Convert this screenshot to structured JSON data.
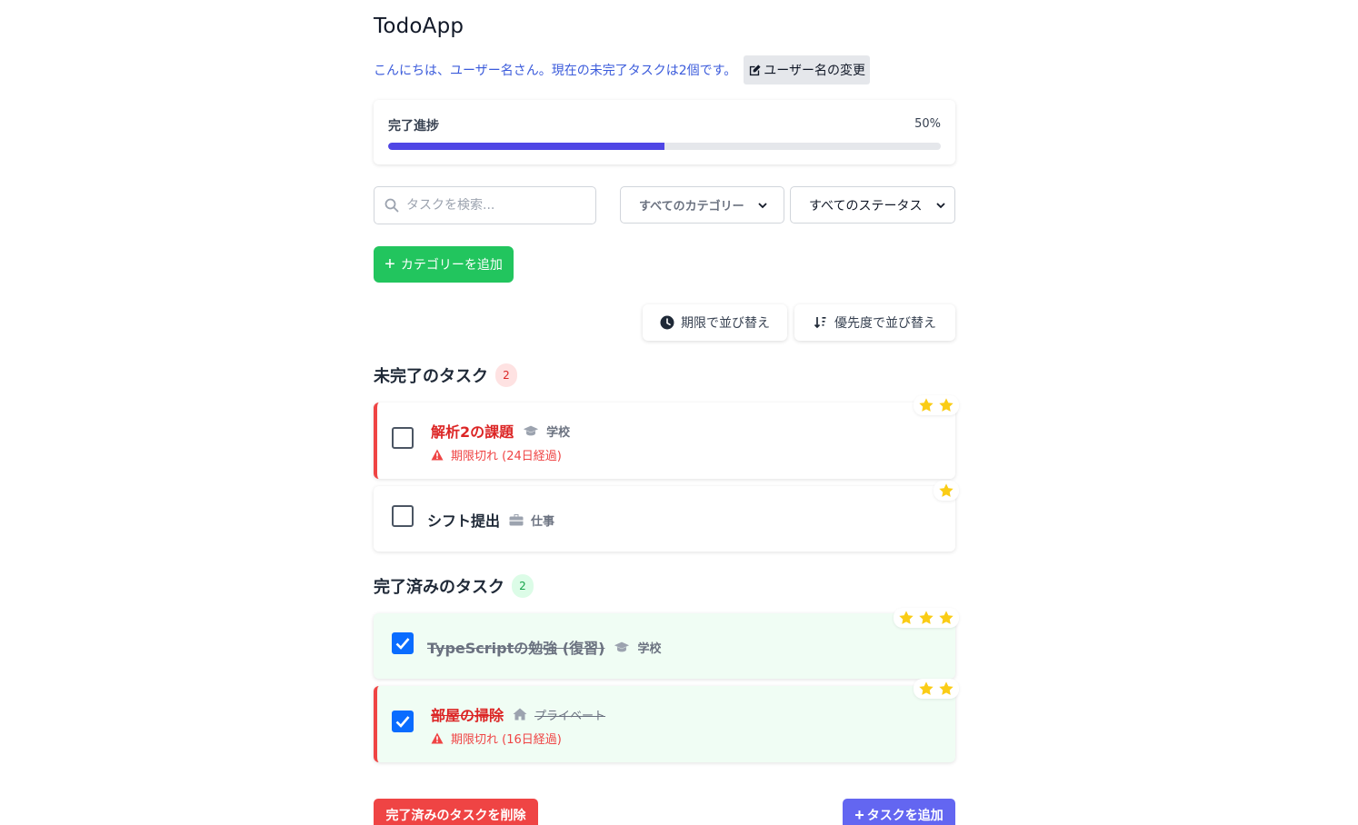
{
  "app": {
    "title": "TodoApp",
    "greeting": "こんにちは、ユーザー名さん。現在の未完了タスクは2個です。",
    "rename_label": "ユーザー名の変更"
  },
  "progress": {
    "label": "完了進捗",
    "percent_text": "50%",
    "value": 0.5,
    "fill_color": "#4f46e5"
  },
  "filters": {
    "search_placeholder": "タスクを検索...",
    "category_selected": "すべてのカテゴリー",
    "status_selected": "すべてのステータス"
  },
  "add_category_label": "カテゴリーを追加",
  "sort": {
    "by_date_label": "期限で並び替え",
    "by_priority_label": "優先度で並び替え"
  },
  "incomplete": {
    "title": "未完了のタスク",
    "count": "2",
    "tasks": [
      {
        "title": "解析2の課題",
        "category": "学校",
        "category_icon": "graduation-cap-icon",
        "overdue_text": "期限切れ (24日経過)",
        "stars": 2,
        "checked": false
      },
      {
        "title": "シフト提出",
        "category": "仕事",
        "category_icon": "briefcase-icon",
        "stars": 1,
        "checked": false
      }
    ]
  },
  "completed": {
    "title": "完了済みのタスク",
    "count": "2",
    "tasks": [
      {
        "title": "TypeScriptの勉強 (復習)",
        "category": "学校",
        "category_icon": "graduation-cap-icon",
        "stars": 3,
        "checked": true
      },
      {
        "title": "部屋の掃除",
        "category": "プライベート",
        "category_icon": "home-icon",
        "overdue_text": "期限切れ (16日経過)",
        "stars": 2,
        "checked": true
      }
    ]
  },
  "footer": {
    "clear_completed_label": "完了済みのタスクを削除",
    "add_task_label": "タスクを追加"
  },
  "colors": {
    "accent": "#4f46e5",
    "success": "#22c55e",
    "danger": "#ef4444",
    "star": "#facc15"
  }
}
